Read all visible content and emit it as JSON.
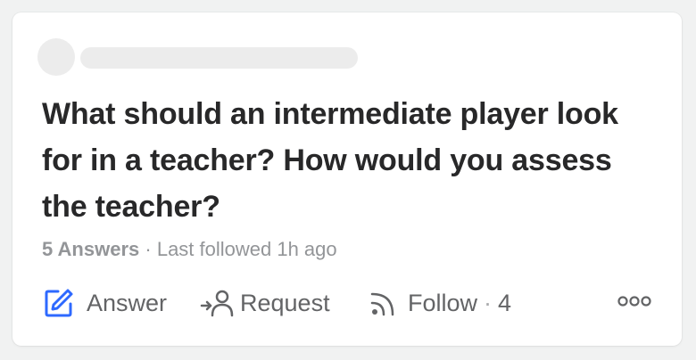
{
  "question": {
    "title": "What should an intermediate player look for in a teacher? How would you assess the teacher?"
  },
  "meta": {
    "answers_label": "5 Answers",
    "separator": "·",
    "last_followed": "Last followed 1h ago"
  },
  "actions": {
    "answer_label": "Answer",
    "request_label": "Request",
    "follow_label": "Follow",
    "follow_separator": "·",
    "follow_count": "4"
  },
  "icons": {
    "answer": "edit-pen-icon",
    "request": "request-person-icon",
    "follow": "rss-follow-icon",
    "more": "more-options-icon"
  },
  "colors": {
    "accent": "#2e69ff",
    "text_primary": "#282829",
    "text_secondary": "#636466",
    "text_muted": "#939598",
    "placeholder": "#ececec"
  }
}
